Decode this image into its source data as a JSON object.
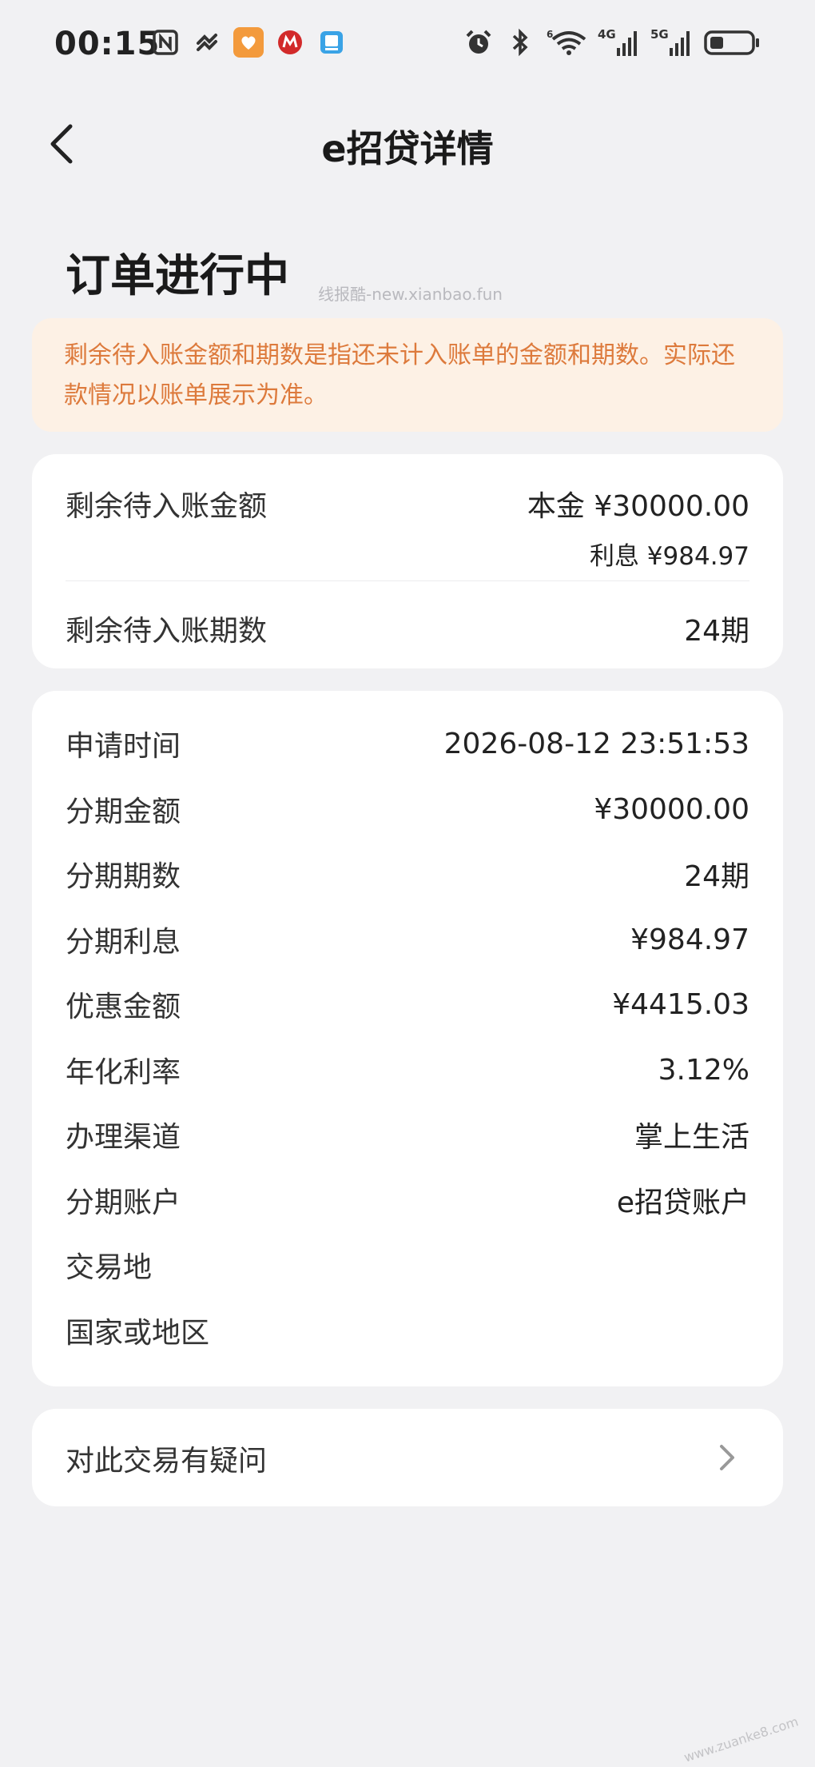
{
  "status_bar": {
    "time": "00:15",
    "left_icons": [
      "nfc-icon",
      "health-app-icon",
      "heart-app-icon",
      "cmb-app-icon",
      "app-download-icon"
    ],
    "right_icons": [
      "alarm-icon",
      "bluetooth-icon",
      "wifi-icon",
      "signal-4g-icon",
      "signal-5g-icon",
      "battery-icon"
    ],
    "signal_4g_label": "4G",
    "signal_5g_label": "5G",
    "wifi_label": "6"
  },
  "header": {
    "title": "e招贷详情"
  },
  "order_status": "订单进行中",
  "watermark": "线报酷-new.xianbao.fun",
  "notice": "剩余待入账金额和期数是指还未计入账单的金额和期数。实际还款情况以账单展示为准。",
  "pending": {
    "amount_label": "剩余待入账金额",
    "principal": "本金 ¥30000.00",
    "interest": "利息 ¥984.97",
    "periods_label": "剩余待入账期数",
    "periods_value": "24期"
  },
  "details": [
    {
      "label": "申请时间",
      "value": "2026-08-12 23:51:53"
    },
    {
      "label": "分期金额",
      "value": "¥30000.00"
    },
    {
      "label": "分期期数",
      "value": "24期"
    },
    {
      "label": "分期利息",
      "value": "¥984.97"
    },
    {
      "label": "优惠金额",
      "value": "¥4415.03"
    },
    {
      "label": "年化利率",
      "value": "3.12%"
    },
    {
      "label": "办理渠道",
      "value": "掌上生活"
    },
    {
      "label": "分期账户",
      "value": "e招贷账户"
    },
    {
      "label": "交易地",
      "value": ""
    },
    {
      "label": "国家或地区",
      "value": ""
    }
  ],
  "question": {
    "label": "对此交易有疑问"
  },
  "corner_mark": "www.zuanke8.com",
  "colors": {
    "background": "#f1f1f3",
    "notice_bg": "#fdf1e5",
    "notice_text": "#dd7a3c",
    "card_bg": "#ffffff"
  }
}
